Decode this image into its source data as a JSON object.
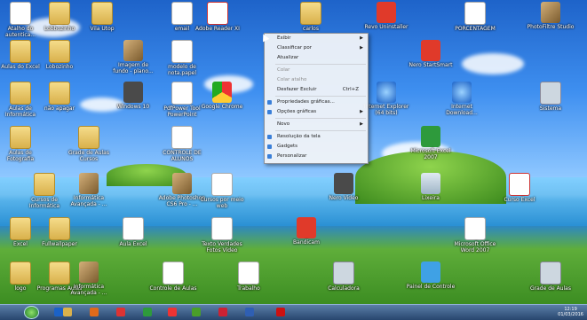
{
  "desktop_icons": [
    {
      "label": "Atalho do\nautentica...",
      "kind": "doc"
    },
    {
      "label": "Lobbozinho",
      "kind": "folder"
    },
    {
      "label": "Vila Utop",
      "kind": "folder"
    },
    {
      "label": "email",
      "kind": "doc"
    },
    {
      "label": "Adobe Reader XI",
      "kind": "pdf"
    },
    {
      "label": "carlos",
      "kind": "folder"
    },
    {
      "label": "Revo Uninstaller",
      "kind": "red"
    },
    {
      "label": "PORCENTAGEM",
      "kind": "doc"
    },
    {
      "label": "PhotoFiltre Studio",
      "kind": "ico-photo"
    },
    {
      "label": "Aulas do Excel",
      "kind": "folder"
    },
    {
      "label": "Lobozinho",
      "kind": "folder"
    },
    {
      "label": "Imagem de\nfundo - plano...",
      "kind": "ico-photo"
    },
    {
      "label": "modelo de\nnota.papel",
      "kind": "doc"
    },
    {
      "label": "Nero StartSmart",
      "kind": "red"
    },
    {
      "label": "Aulas de\nInformática",
      "kind": "folder"
    },
    {
      "label": "não apagar",
      "kind": "folder"
    },
    {
      "label": "Windows 10",
      "kind": "ico-film"
    },
    {
      "label": "PdfPower Tool\nPowerPoint",
      "kind": "doc"
    },
    {
      "label": "Google Chrome",
      "kind": "chrome"
    },
    {
      "label": "Internet Explorer\n(64 bits)",
      "kind": "ie"
    },
    {
      "label": "Internet\nDownload...",
      "kind": "ie"
    },
    {
      "label": "Sistema",
      "kind": "ico-calc"
    },
    {
      "label": "Aulas de\nFotografia",
      "kind": "folder"
    },
    {
      "label": "Grade de Aulas\nCursos",
      "kind": "folder"
    },
    {
      "label": "CONTROLE DE\nALUNOS",
      "kind": "doc"
    },
    {
      "label": "Microsoft Excel\n2007",
      "kind": "ico-green"
    },
    {
      "label": "Cursos de\nInformática",
      "kind": "folder"
    },
    {
      "label": "Informática\nAvançada - ...",
      "kind": "ico-photo"
    },
    {
      "label": "Adobe Photoshop\nCS6 Pro - ...",
      "kind": "ico-photo"
    },
    {
      "label": "Cursos por meio\nweb",
      "kind": "doc"
    },
    {
      "label": "Nero Video",
      "kind": "ico-film"
    },
    {
      "label": "Lixeira",
      "kind": "ico-trash"
    },
    {
      "label": "Curso Excel",
      "kind": "pdf"
    },
    {
      "label": "Excel",
      "kind": "folder"
    },
    {
      "label": "Fullwallpaper",
      "kind": "folder"
    },
    {
      "label": "Aula Excel",
      "kind": "doc"
    },
    {
      "label": "Texto Verdades\nFotos Vídeo",
      "kind": "doc"
    },
    {
      "label": "Bandicam",
      "kind": "red"
    },
    {
      "label": "Microsoft Office\nWord 2007",
      "kind": "doc"
    },
    {
      "label": "logo",
      "kind": "folder"
    },
    {
      "label": "Programas Aulas",
      "kind": "folder"
    },
    {
      "label": "Informática\nAvançada - ...",
      "kind": "ico-photo"
    },
    {
      "label": "Controle de Aulas",
      "kind": "doc"
    },
    {
      "label": "Trabalho",
      "kind": "doc"
    },
    {
      "label": "Calculadora",
      "kind": "ico-calc"
    },
    {
      "label": "Painel de Controle",
      "kind": "ico-gear"
    },
    {
      "label": "Grade de Aulas",
      "kind": "ico-calc"
    }
  ],
  "context_menu": {
    "items": [
      {
        "label": "Exibir",
        "submenu": true
      },
      {
        "label": "Classificar por",
        "submenu": true
      },
      {
        "label": "Atualizar"
      },
      {
        "sep": true
      },
      {
        "label": "Colar",
        "disabled": true
      },
      {
        "label": "Colar atalho",
        "disabled": true
      },
      {
        "label": "Desfazer Excluir",
        "shortcut": "Ctrl+Z"
      },
      {
        "sep": true
      },
      {
        "label": "Propriedades gráficas...",
        "icon": true
      },
      {
        "label": "Opções gráficas",
        "submenu": true,
        "icon": true
      },
      {
        "sep": true
      },
      {
        "label": "Novo",
        "submenu": true
      },
      {
        "sep": true
      },
      {
        "label": "Resolução da tela",
        "icon": true
      },
      {
        "label": "Gadgets",
        "icon": true
      },
      {
        "label": "Personalizar",
        "icon": true
      }
    ]
  },
  "taskbar": {
    "pinned": [
      "ie-icon",
      "folder-icon",
      "media-player-icon",
      "paint-icon",
      "excel-icon",
      "chrome-icon",
      "utorrent-icon",
      "flash-icon",
      "word-icon",
      "bandicam-icon"
    ],
    "clock": {
      "time": "12:19",
      "date": "01/03/2016"
    }
  }
}
